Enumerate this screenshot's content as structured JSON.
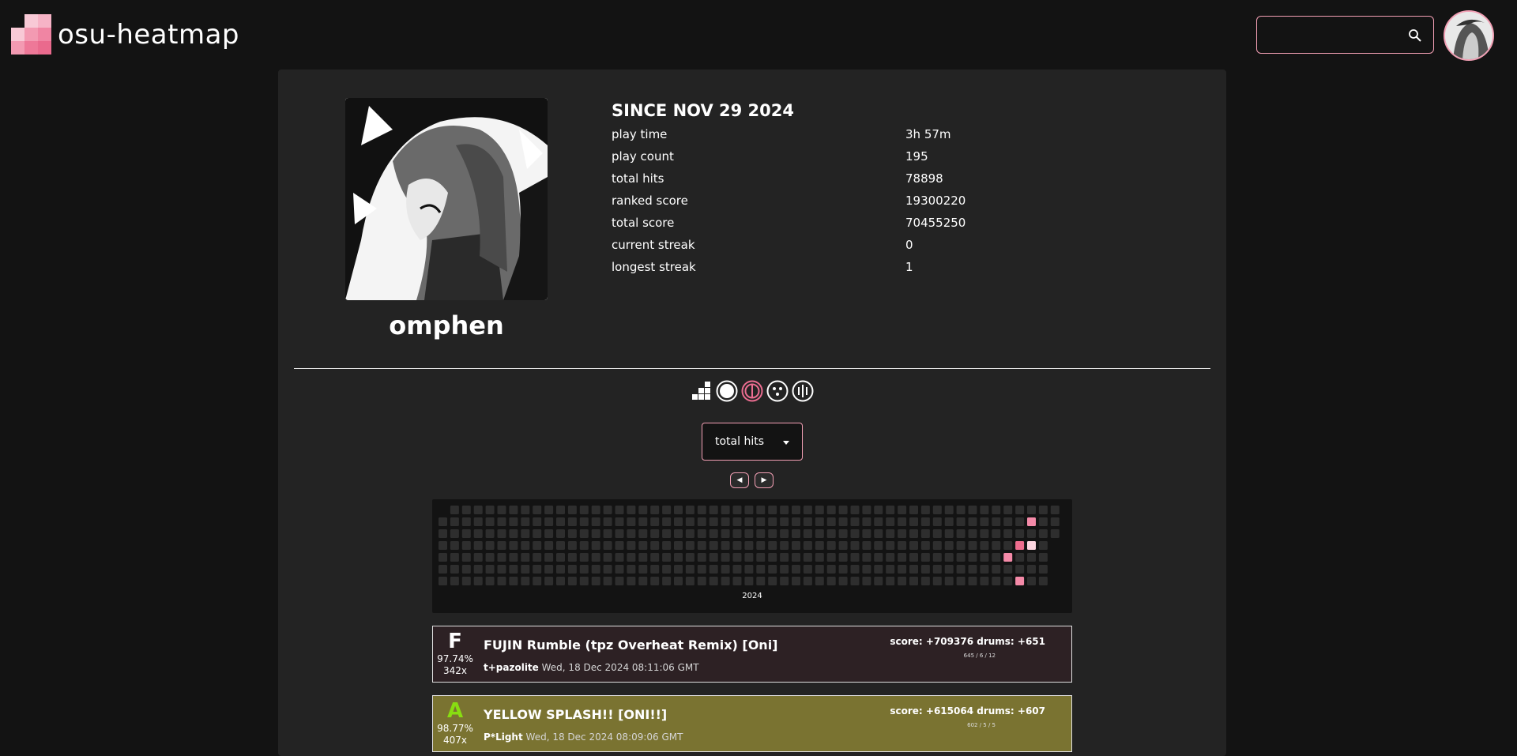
{
  "app": {
    "name": "osu-heatmap"
  },
  "search": {
    "value": "",
    "placeholder": ""
  },
  "profile": {
    "username": "omphen",
    "since": "SINCE NOV 29 2024",
    "stats": [
      {
        "label": "play time",
        "value": "3h 57m"
      },
      {
        "label": "play count",
        "value": "195"
      },
      {
        "label": "total hits",
        "value": "78898"
      },
      {
        "label": "ranked score",
        "value": "19300220"
      },
      {
        "label": "total score",
        "value": "70455250"
      },
      {
        "label": "current streak",
        "value": "0"
      },
      {
        "label": "longest streak",
        "value": "1"
      }
    ]
  },
  "modes": [
    {
      "icon": "grid-icon",
      "active": false
    },
    {
      "icon": "osu-standard-icon",
      "active": false
    },
    {
      "icon": "taiko-icon",
      "active": true
    },
    {
      "icon": "catch-icon",
      "active": false
    },
    {
      "icon": "mania-icon",
      "active": false
    }
  ],
  "metric_select": {
    "value": "total hits"
  },
  "nav": {
    "prev": "◀",
    "next": "▶"
  },
  "heatmap": {
    "year_label": "2024",
    "colors": {
      "empty": "#2e2e2e",
      "low": "#f48aa8",
      "mid": "#ee6d8e",
      "high": "#fdd6e0"
    },
    "active_days": [
      {
        "week": 50,
        "day": 1,
        "level": "low"
      },
      {
        "week": 50,
        "day": 3,
        "level": "high"
      },
      {
        "week": 49,
        "day": 3,
        "level": "mid"
      },
      {
        "week": 48,
        "day": 4,
        "level": "low"
      },
      {
        "week": 49,
        "day": 6,
        "level": "low"
      }
    ]
  },
  "scores": [
    {
      "grade": "F",
      "accuracy": "97.74%",
      "combo": "342x",
      "title": "FUJIN Rumble (tpz Overheat Remix) [Oni]",
      "artist": "t+pazolite",
      "date": "Wed, 18 Dec 2024 08:11:06 GMT",
      "score_text": "score: +709376  drums: +651",
      "hits": "645 / 6 / 12",
      "grade_color": "#ffffff",
      "bg_color": "#2d2124"
    },
    {
      "grade": "A",
      "accuracy": "98.77%",
      "combo": "407x",
      "title": "YELLOW SPLASH!! [ONI!!]",
      "artist": "P*Light",
      "date": "Wed, 18 Dec 2024 08:09:06 GMT",
      "score_text": "score: +615064  drums: +607",
      "hits": "602 / 5 / 5",
      "grade_color": "#88dd11",
      "bg_color": "#7a7331"
    }
  ],
  "colors": {
    "accent": "#f29fb4",
    "page_bg": "#131313",
    "panel_bg": "#232323"
  }
}
